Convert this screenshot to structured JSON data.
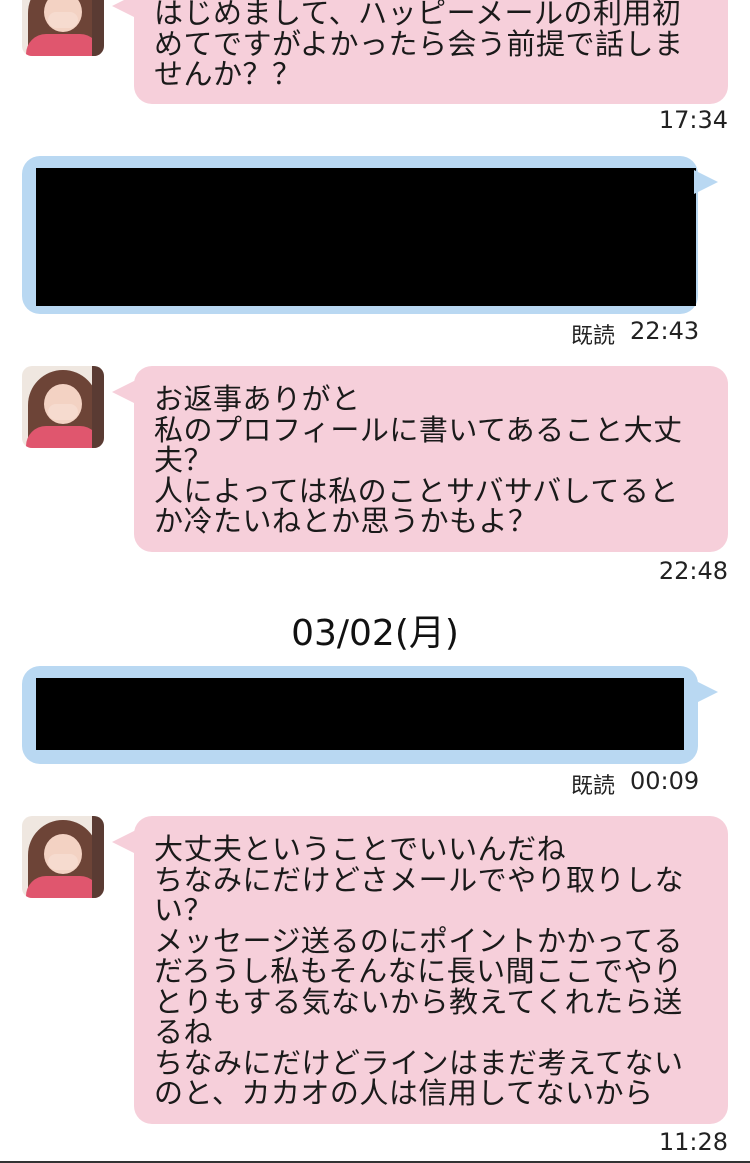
{
  "messages": [
    {
      "id": "m1",
      "side": "in",
      "text": "はじめまして、ハッピーメールの利用初\nめてですがよかったら会う前提で話しま\nせんか？？",
      "time": "17:34"
    },
    {
      "id": "m2",
      "side": "out",
      "redacted": true,
      "read_label": "既読",
      "time": "22:43"
    },
    {
      "id": "m3",
      "side": "in",
      "text": "お返事ありがと\n私のプロフィールに書いてあること大丈\n夫？\n人によっては私のことサバサバしてると\nか冷たいねとか思うかもよ？",
      "time": "22:48"
    },
    {
      "id": "m4",
      "side": "out",
      "redacted": true,
      "read_label": "既読",
      "time": "00:09"
    },
    {
      "id": "m5",
      "side": "in",
      "text": "大丈夫ということでいいんだね\nちなみにだけどさメールでやり取りしな\nい？\nメッセージ送るのにポイントかかってる\nだろうし私もそんなに長い間ここでやり\nとりもする気ないから教えてくれたら送\nるね\nちなみにだけどラインはまだ考えてない\nのと、カカオの人は信用してないから",
      "time": "11:28"
    }
  ],
  "date_separator": "03/02(月)",
  "colors": {
    "incoming_bubble": "#f6cfda",
    "outgoing_bubble": "#b9d8f2",
    "redaction": "#000000"
  },
  "icons": {
    "avatar": "user-avatar-icon"
  }
}
